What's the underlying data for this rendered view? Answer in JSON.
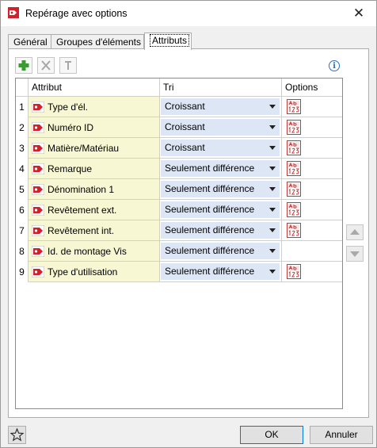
{
  "window": {
    "title": "Repérage avec options",
    "close_glyph": "✕"
  },
  "tabs": [
    {
      "label": "Général"
    },
    {
      "label": "Groupes d'éléments"
    },
    {
      "label": "Attributs"
    }
  ],
  "toolbar": {
    "add_icon": "plus-icon",
    "delete_icon": "delete-x-icon",
    "reset_icon": "up-pin-icon",
    "info_glyph": "i"
  },
  "grid": {
    "headers": {
      "attribut": "Attribut",
      "tri": "Tri",
      "options": "Options"
    },
    "rows": [
      {
        "num": "1",
        "attribut": "Type d'él.",
        "tri": "Croissant",
        "has_option": true
      },
      {
        "num": "2",
        "attribut": "Numéro ID",
        "tri": "Croissant",
        "has_option": true
      },
      {
        "num": "3",
        "attribut": "Matière/Matériau",
        "tri": "Croissant",
        "has_option": true
      },
      {
        "num": "4",
        "attribut": "Remarque",
        "tri": "Seulement différence",
        "has_option": true
      },
      {
        "num": "5",
        "attribut": "Dénomination 1",
        "tri": "Seulement différence",
        "has_option": true
      },
      {
        "num": "6",
        "attribut": "Revêtement ext.",
        "tri": "Seulement différence",
        "has_option": true
      },
      {
        "num": "7",
        "attribut": "Revêtement int.",
        "tri": "Seulement différence",
        "has_option": true
      },
      {
        "num": "8",
        "attribut": "Id. de montage Vis",
        "tri": "Seulement différence",
        "has_option": false
      },
      {
        "num": "9",
        "attribut": "Type d'utilisation",
        "tri": "Seulement différence",
        "has_option": true
      }
    ]
  },
  "footer": {
    "ok_label": "OK",
    "cancel_label": "Annuler"
  },
  "colors": {
    "attr_bg": "#f7f7d3",
    "combo_bg": "#dde6f5",
    "accent": "#0078d7",
    "brand_red": "#d4202a"
  }
}
